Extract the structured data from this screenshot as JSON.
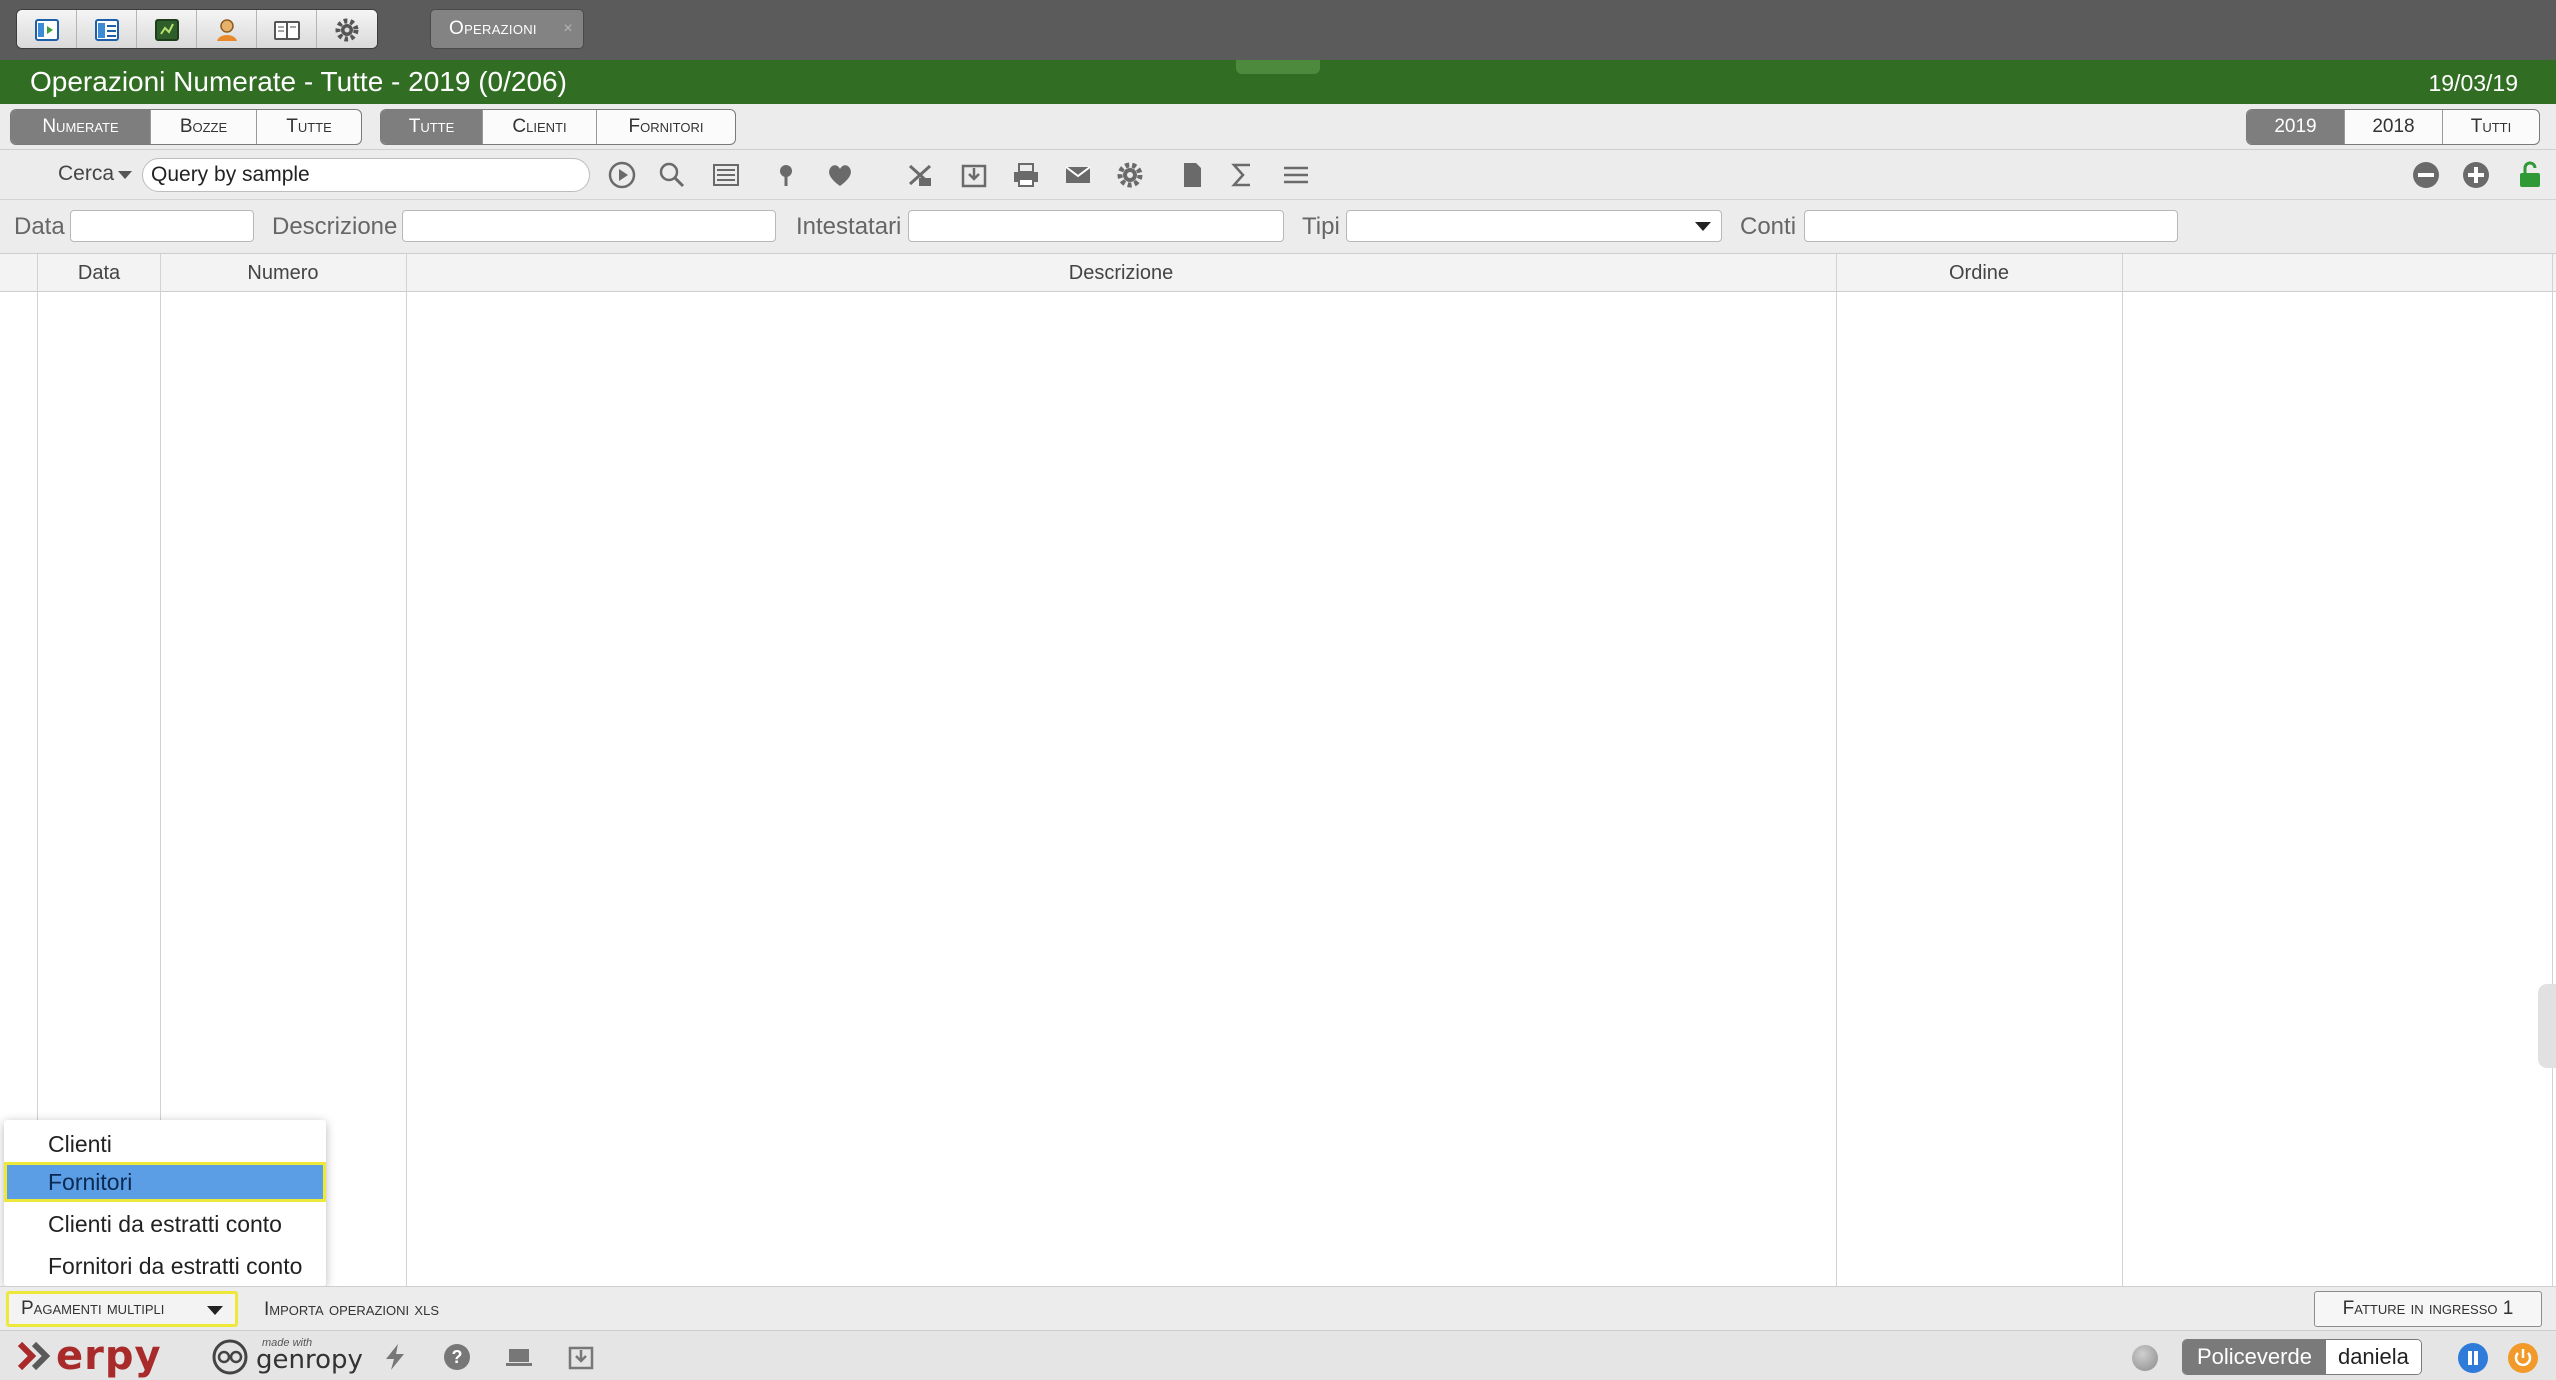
{
  "top_bar": {
    "app_icons": [
      "home-icon",
      "table-icon",
      "accounting-icon",
      "user-icon",
      "book-icon",
      "gear-icon"
    ],
    "open_tab": {
      "label": "Operazioni",
      "close": "×"
    }
  },
  "title_bar": {
    "title": "Operazioni Numerate - Tutte - 2019 (0/206)",
    "date": "19/03/19"
  },
  "filters": {
    "status": [
      "Numerate",
      "Bozze",
      "Tutte"
    ],
    "status_active": "Numerate",
    "party": [
      "Tutte",
      "Clienti",
      "Fornitori"
    ],
    "party_active": "Tutte",
    "year": [
      "2019",
      "2018",
      "Tutti"
    ],
    "year_active": "2019"
  },
  "toolbar": {
    "search_label": "Cerca",
    "search_value": "Query by sample",
    "tools": [
      "run-icon",
      "search-icon",
      "list-icon",
      "pin-icon",
      "heart-icon",
      "excel-icon",
      "download-icon",
      "print-icon",
      "mail-icon",
      "gear-icon",
      "document-icon",
      "sum-icon",
      "menu-icon"
    ],
    "right_tools": [
      "minus-icon",
      "plus-icon",
      "lock-icon"
    ]
  },
  "field_filters": {
    "data": "Data",
    "descrizione": "Descrizione",
    "intestatari": "Intestatari",
    "tipi": "Tipi",
    "conti": "Conti"
  },
  "grid": {
    "columns": [
      "Data",
      "Numero",
      "Descrizione",
      "Ordine"
    ]
  },
  "dropdown": {
    "items": [
      "Clienti",
      "Fornitori",
      "Clienti da estratti conto",
      "Fornitori da estratti conto"
    ],
    "selected": "Fornitori"
  },
  "action_bar": {
    "pagamenti": "Pagamenti multipli",
    "importa": "Importa operazioni xls",
    "fatture": "Fatture in ingresso 1"
  },
  "footer": {
    "brand": "erpy",
    "made_with": "made with",
    "framework": "genropy",
    "company": "Policeverde",
    "user": "daniela"
  },
  "colors": {
    "title_green": "#316e23",
    "top_gray": "#5b5b5b",
    "selected_blue": "#5c9ee6",
    "highlight_yellow": "#eee83a",
    "brand_red": "#a82a2a"
  }
}
